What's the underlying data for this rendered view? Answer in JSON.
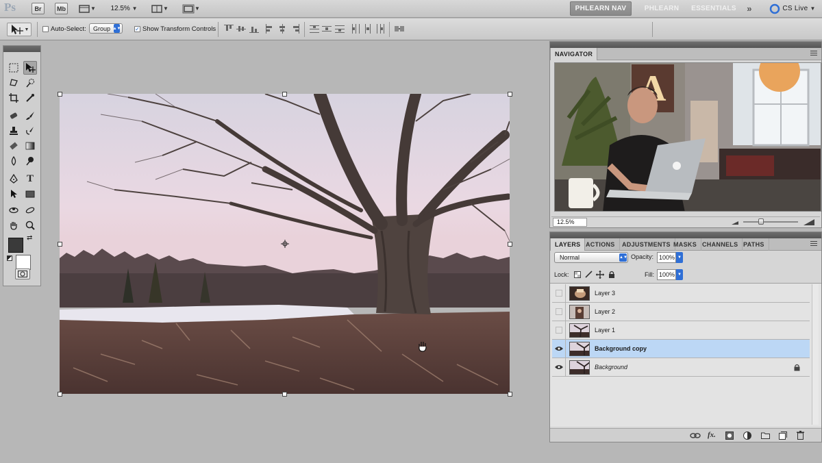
{
  "appbar": {
    "logo": "Ps",
    "br_label": "Br",
    "mb_label": "Mb",
    "zoom": "12.5%",
    "workspaces": [
      "PHLEARN NAV",
      "PHLEARN",
      "ESSENTIALS"
    ],
    "more": "»",
    "cs_live": "CS Live"
  },
  "options": {
    "auto_select_label": "Auto-Select:",
    "auto_select_checked": false,
    "group_value": "Group",
    "show_transform_label": "Show Transform Controls",
    "show_transform_checked": true
  },
  "navigator": {
    "tab": "NAVIGATOR",
    "zoom": "12.5%",
    "sign_letter": "A"
  },
  "layers": {
    "tabs": [
      "LAYERS",
      "ACTIONS",
      "ADJUSTMENTS",
      "MASKS",
      "CHANNELS",
      "PATHS"
    ],
    "blend_mode": "Normal",
    "opacity_label": "Opacity:",
    "opacity": "100%",
    "lock_label": "Lock:",
    "fill_label": "Fill:",
    "fill": "100%",
    "items": [
      {
        "name": "Layer 3",
        "visible": false,
        "selected": false
      },
      {
        "name": "Layer 2",
        "visible": false,
        "selected": false
      },
      {
        "name": "Layer 1",
        "visible": false,
        "selected": false
      },
      {
        "name": "Background copy",
        "visible": true,
        "selected": true
      },
      {
        "name": "Background",
        "visible": true,
        "selected": false,
        "locked": true
      }
    ]
  },
  "icons": {
    "move_tool": "move-tool-icon",
    "hand_cursor": "hand-cursor-icon",
    "eye": "eye-icon",
    "lock": "lock-icon"
  },
  "colors": {
    "accent": "#2f6fd6",
    "selected_layer": "#bcd7f5",
    "foreground_swatch": "#3a3a3a",
    "background_swatch": "#ffffff"
  }
}
